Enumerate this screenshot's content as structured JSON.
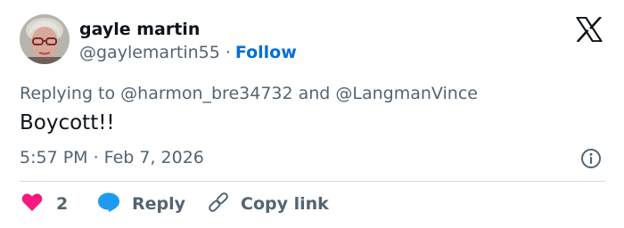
{
  "author": {
    "display_name": "gayle martin",
    "handle": "@gaylemartin55",
    "separator": "·",
    "follow_label": "Follow"
  },
  "reply_context": "Replying to @harmon_bre34732 and @LangmanVince",
  "tweet_text": "Boycott!!",
  "timestamp": "5:57 PM · Feb 7, 2026",
  "actions": {
    "like_count": "2",
    "reply_label": "Reply",
    "copy_link_label": "Copy link"
  },
  "icons": {
    "brand": "x-logo-icon",
    "info": "info-icon",
    "like": "heart-icon",
    "reply": "speech-bubble-icon",
    "copy": "link-icon"
  },
  "colors": {
    "text_primary": "#0f1419",
    "text_secondary": "#536471",
    "follow_blue": "#006fd6",
    "heart": "#f91880",
    "reply_bubble": "#1d9bf0",
    "divider": "#cfd9de"
  }
}
